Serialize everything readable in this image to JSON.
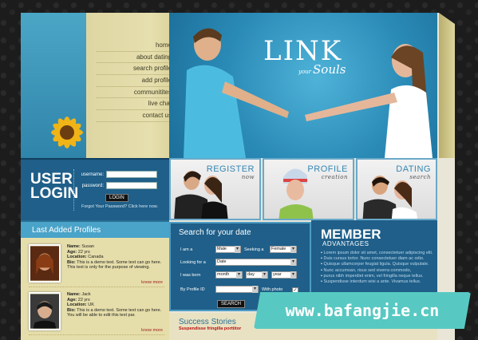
{
  "nav": [
    "home",
    "about dating",
    "search profile",
    "add profile",
    "communitites",
    "live chat",
    "contact us"
  ],
  "hero": {
    "brand": "LINK",
    "sub_small": "your",
    "sub_big": "Souls"
  },
  "login": {
    "title_line1": "USER",
    "title_line2": "LOGIN",
    "username_label": "username:",
    "password_label": "password:",
    "button": "LOGIN",
    "forgot": "Forgot Your Password? Click here now."
  },
  "features": [
    {
      "title": "REGISTER",
      "sub": "now"
    },
    {
      "title": "PROFILE",
      "sub": "creation"
    },
    {
      "title": "DATING",
      "sub": "search"
    }
  ],
  "profiles": {
    "title": "Last Added Profiles",
    "items": [
      {
        "name_label": "Name:",
        "name": "Susan",
        "age_label": "Age:",
        "age": "22 yrs",
        "location_label": "Location:",
        "location": "Canada",
        "bio_label": "Bio:",
        "bio": "This is a demo text. Some text can go here. This text is only for the purpose of viewing.",
        "more": "know more"
      },
      {
        "name_label": "Name:",
        "name": "Jack",
        "age_label": "Age:",
        "age": "22 yrs",
        "location_label": "Location:",
        "location": "UK",
        "bio_label": "Bio:",
        "bio": "This is a demo text. Some text can go here. You will be able to edit this text par.",
        "more": "know more"
      }
    ]
  },
  "search": {
    "title": "Search for your date",
    "i_am_label": "I am a",
    "i_am_value": "Male",
    "seeking_label": "Seeking a",
    "seeking_value": "Female",
    "looking_label": "Looking for a",
    "looking_value": "Date",
    "born_label": "I was born",
    "month": "month",
    "day": "day",
    "year": "year",
    "profile_id_label": "By Profile ID",
    "photo_label": "With photo",
    "photo_check": "✓",
    "button": "SEARCH"
  },
  "member": {
    "title": "MEMBER",
    "sub": "ADVANTAGES",
    "items": [
      "Lorem ipsum dolor sit amet, consectetuer adipiscing elit.",
      "Duis cursus tortor. Nunc consectetuer diam ac odio.",
      "Quisque ullamcorper feugiat ligula. Quisque vulputate.",
      "Nunc accumsan, risus sed viverra commodo,",
      "purus nibh imperdiet enim, vel fringilla neque tellus.",
      "Suspendisse interdum wisi a ante. Vivamus tellus."
    ]
  },
  "success": {
    "title": "Success Stories",
    "sub": "Suspendisse fringilla porttitor"
  },
  "watermark": "www.bafangjie.cn",
  "colors": {
    "accent": "#1f5f89",
    "light_blue": "#4aa3c8",
    "sand": "#e6deaa"
  }
}
